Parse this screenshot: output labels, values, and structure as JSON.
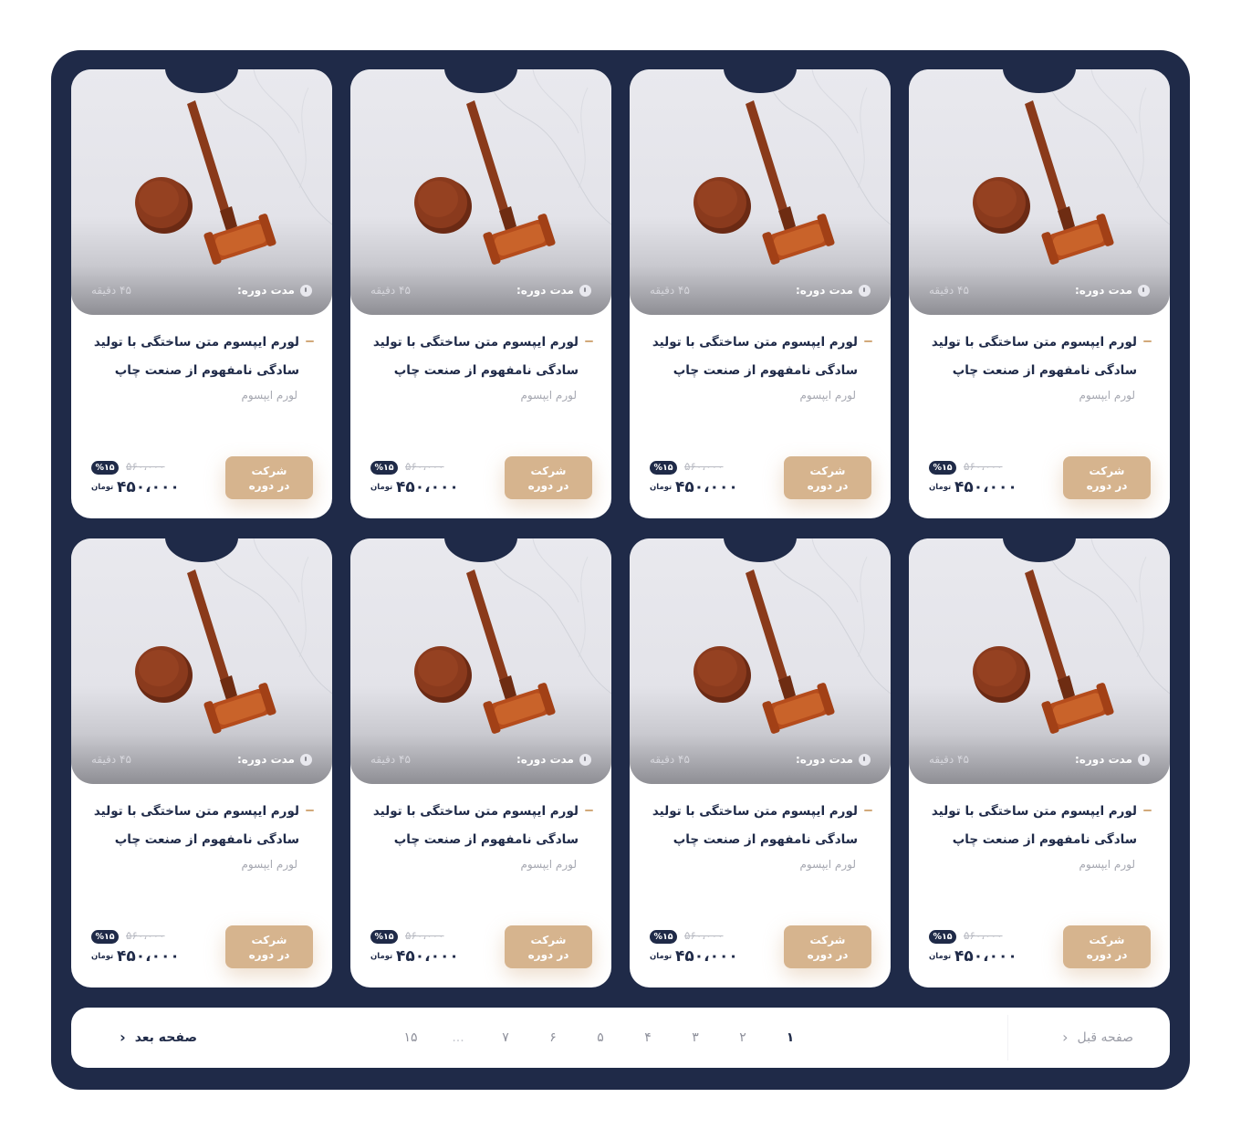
{
  "courses": [
    {
      "duration_label": "مدت دوره:",
      "duration_value": "۴۵ دقیقه",
      "title": "لورم ایپسوم متن ساختگی با تولید سادگی نامفهوم از صنعت چاپ",
      "author": "لورم ایپسوم",
      "button_line1": "شرکت",
      "button_line2": "در دوره",
      "discount": "%۱۵",
      "old_price": "۵۶۰،۰۰۰",
      "price": "۴۵۰،۰۰۰",
      "currency": "تومان"
    },
    {
      "duration_label": "مدت دوره:",
      "duration_value": "۴۵ دقیقه",
      "title": "لورم ایپسوم متن ساختگی با تولید سادگی نامفهوم از صنعت چاپ",
      "author": "لورم ایپسوم",
      "button_line1": "شرکت",
      "button_line2": "در دوره",
      "discount": "%۱۵",
      "old_price": "۵۶۰،۰۰۰",
      "price": "۴۵۰،۰۰۰",
      "currency": "تومان"
    },
    {
      "duration_label": "مدت دوره:",
      "duration_value": "۴۵ دقیقه",
      "title": "لورم ایپسوم متن ساختگی با تولید سادگی نامفهوم از صنعت چاپ",
      "author": "لورم ایپسوم",
      "button_line1": "شرکت",
      "button_line2": "در دوره",
      "discount": "%۱۵",
      "old_price": "۵۶۰،۰۰۰",
      "price": "۴۵۰،۰۰۰",
      "currency": "تومان"
    },
    {
      "duration_label": "مدت دوره:",
      "duration_value": "۴۵ دقیقه",
      "title": "لورم ایپسوم متن ساختگی با تولید سادگی نامفهوم از صنعت چاپ",
      "author": "لورم ایپسوم",
      "button_line1": "شرکت",
      "button_line2": "در دوره",
      "discount": "%۱۵",
      "old_price": "۵۶۰،۰۰۰",
      "price": "۴۵۰،۰۰۰",
      "currency": "تومان"
    },
    {
      "duration_label": "مدت دوره:",
      "duration_value": "۴۵ دقیقه",
      "title": "لورم ایپسوم متن ساختگی با تولید سادگی نامفهوم از صنعت چاپ",
      "author": "لورم ایپسوم",
      "button_line1": "شرکت",
      "button_line2": "در دوره",
      "discount": "%۱۵",
      "old_price": "۵۶۰،۰۰۰",
      "price": "۴۵۰،۰۰۰",
      "currency": "تومان"
    },
    {
      "duration_label": "مدت دوره:",
      "duration_value": "۴۵ دقیقه",
      "title": "لورم ایپسوم متن ساختگی با تولید سادگی نامفهوم از صنعت چاپ",
      "author": "لورم ایپسوم",
      "button_line1": "شرکت",
      "button_line2": "در دوره",
      "discount": "%۱۵",
      "old_price": "۵۶۰،۰۰۰",
      "price": "۴۵۰،۰۰۰",
      "currency": "تومان"
    },
    {
      "duration_label": "مدت دوره:",
      "duration_value": "۴۵ دقیقه",
      "title": "لورم ایپسوم متن ساختگی با تولید سادگی نامفهوم از صنعت چاپ",
      "author": "لورم ایپسوم",
      "button_line1": "شرکت",
      "button_line2": "در دوره",
      "discount": "%۱۵",
      "old_price": "۵۶۰،۰۰۰",
      "price": "۴۵۰،۰۰۰",
      "currency": "تومان"
    },
    {
      "duration_label": "مدت دوره:",
      "duration_value": "۴۵ دقیقه",
      "title": "لورم ایپسوم متن ساختگی با تولید سادگی نامفهوم از صنعت چاپ",
      "author": "لورم ایپسوم",
      "button_line1": "شرکت",
      "button_line2": "در دوره",
      "discount": "%۱۵",
      "old_price": "۵۶۰،۰۰۰",
      "price": "۴۵۰،۰۰۰",
      "currency": "تومان"
    }
  ],
  "pagination": {
    "prev_label": "صفحه قبل",
    "next_label": "صفحه بعد",
    "pages": [
      "۱",
      "۲",
      "۳",
      "۴",
      "۵",
      "۶",
      "۷",
      "...",
      "۱۵"
    ],
    "current_page": "۱"
  },
  "colors": {
    "panel": "#1f2a48",
    "accent": "#d6b48e",
    "card": "#ffffff"
  }
}
